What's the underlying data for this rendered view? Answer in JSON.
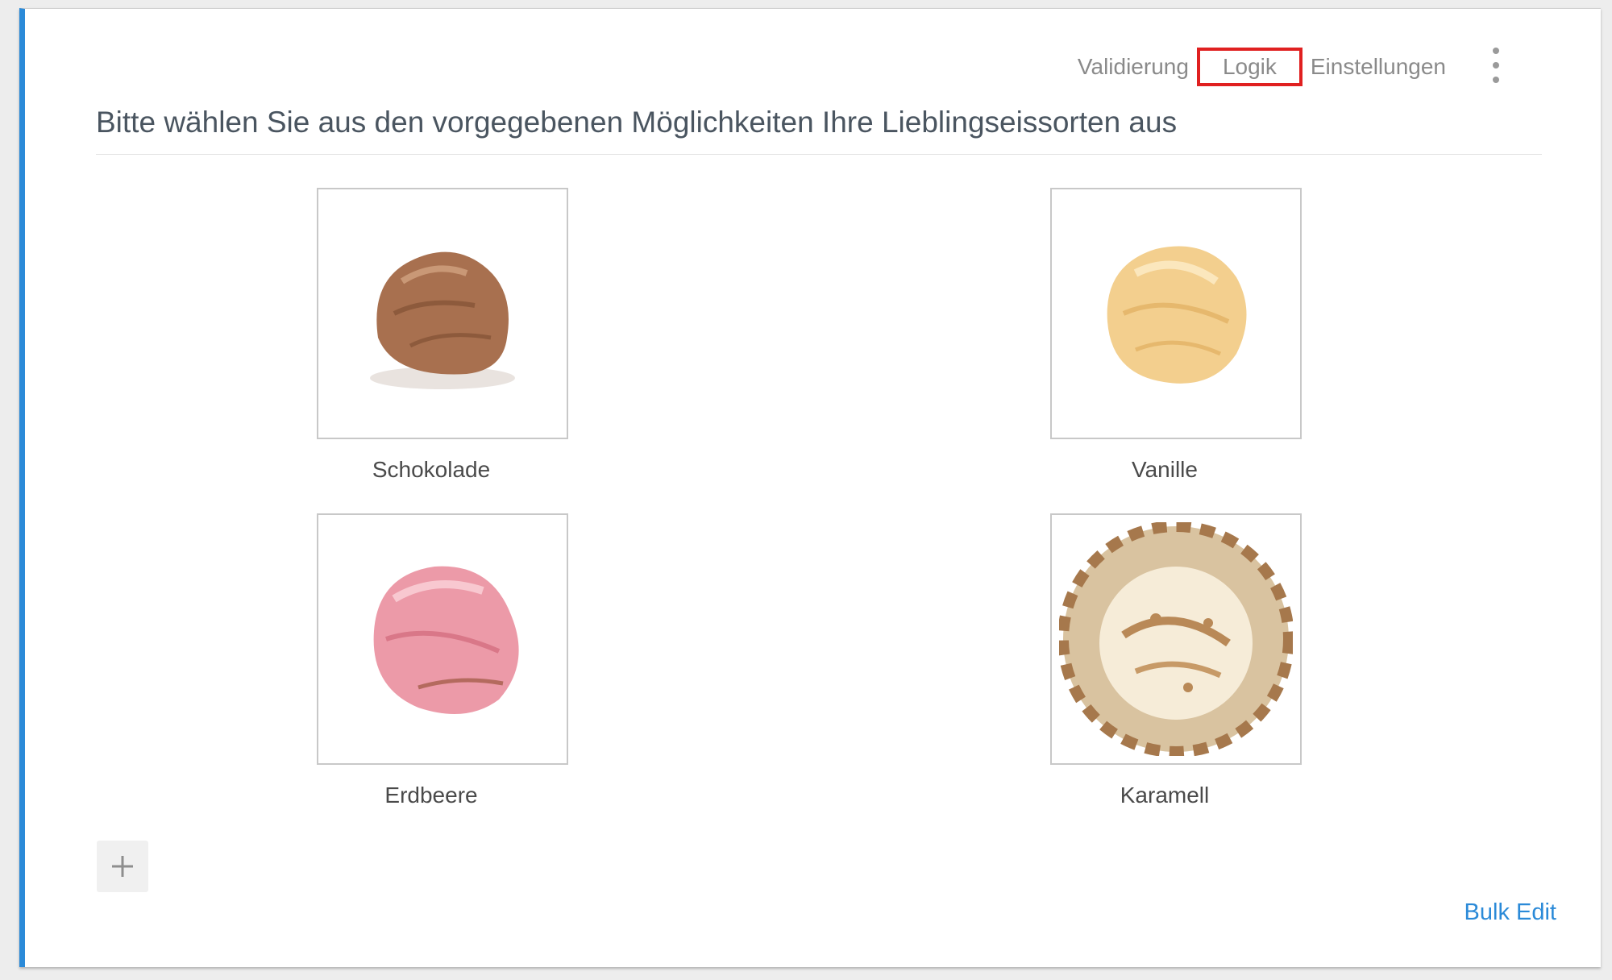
{
  "toolbar": {
    "validierung": "Validierung",
    "logik": "Logik",
    "einstellungen": "Einstellungen"
  },
  "question": {
    "title": "Bitte wählen Sie aus den vorgegebenen Möglichkeiten Ihre Lieblingseissorten aus"
  },
  "choices": [
    {
      "label": "Schokolade",
      "color": "#a8704f",
      "highlight": "#c99876"
    },
    {
      "label": "Vanille",
      "color": "#f3cf8e",
      "highlight": "#fbe7bd"
    },
    {
      "label": "Erdbeere",
      "color": "#ec9aa8",
      "highlight": "#f8c8d0"
    },
    {
      "label": "Karamell",
      "color": "#f2e4c8",
      "highlight": "#b98957"
    }
  ],
  "footer": {
    "bulk_edit": "Bulk Edit"
  },
  "colors": {
    "accent": "#2b8ad8",
    "highlight_box": "#e02020"
  }
}
